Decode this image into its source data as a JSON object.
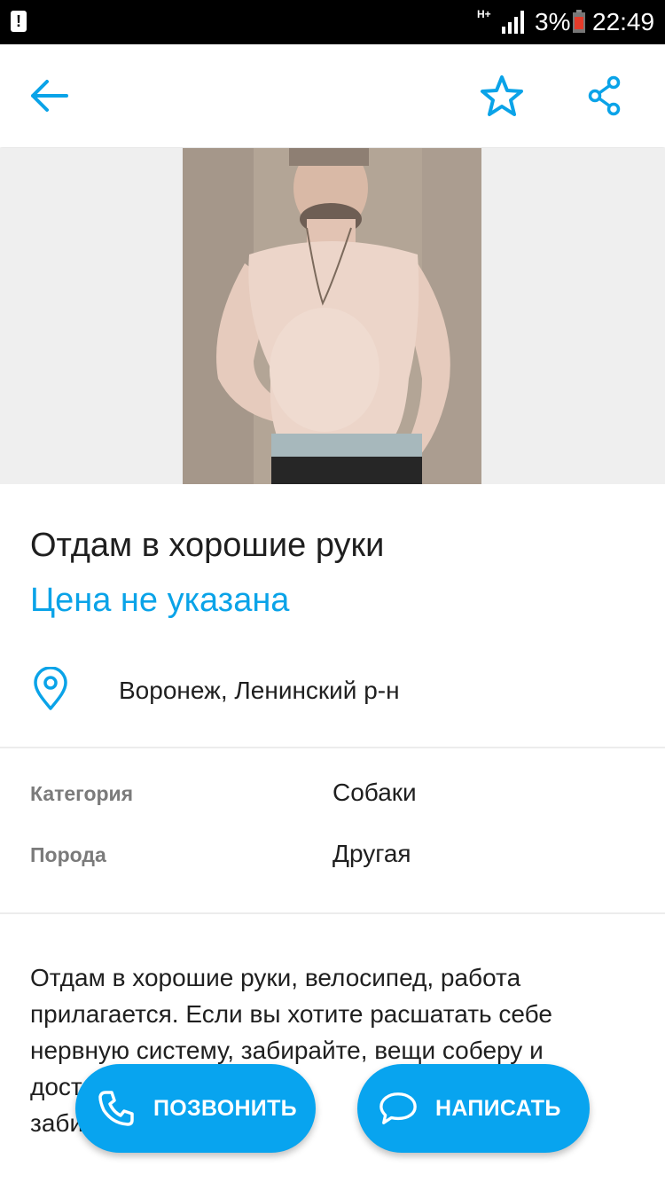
{
  "status_bar": {
    "network": "H+",
    "battery_percent": "3%",
    "time": "22:49",
    "alert": "!"
  },
  "toolbar": {
    "back_icon": "arrow-left-icon",
    "favorite_icon": "star-outline-icon",
    "share_icon": "share-icon",
    "accent_color": "#0aa3e8"
  },
  "listing": {
    "title": "Отдам в хорошие руки",
    "price": "Цена не указана",
    "location": "Воронеж, Ленинский р-н"
  },
  "params": [
    {
      "label": "Категория",
      "value": "Собаки"
    },
    {
      "label": "Порода",
      "value": "Другая"
    }
  ],
  "description": {
    "line1": "Отдам в хорошие руки,  велосипед, работа",
    "line2": "прилагается. Если вы хотите расшатать себе",
    "line3": "нервную систему, забирайте, вещи соберу и",
    "line4": "дост… дене…",
    "line5": "заби… одь…"
  },
  "actions": {
    "call_label": "ПОЗВОНИТЬ",
    "write_label": "НАПИСАТЬ",
    "button_color": "#08a4ef"
  }
}
